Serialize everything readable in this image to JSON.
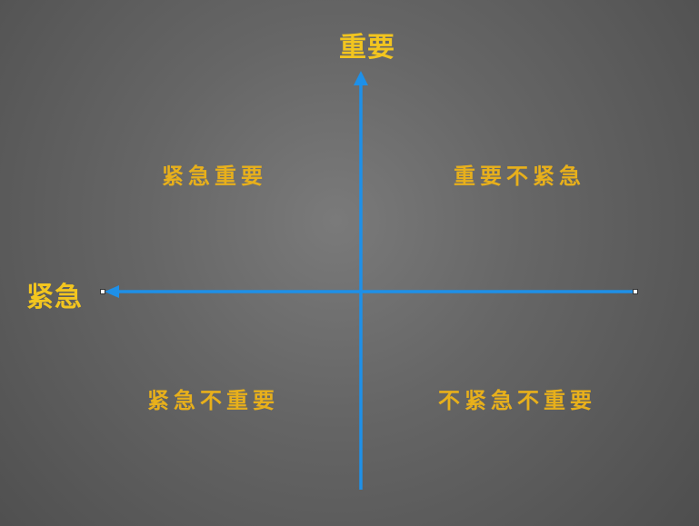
{
  "axes": {
    "vertical_label": "重要",
    "horizontal_label": "紧急"
  },
  "quadrants": {
    "top_left": "紧急重要",
    "top_right": "重要不紧急",
    "bottom_left": "紧急不重要",
    "bottom_right": "不紧急不重要"
  },
  "colors": {
    "axis": "#1e90e8",
    "axis_label": "#f2c51f",
    "quadrant_label": "#e8b01b",
    "endpoint_fill": "#ffffff"
  }
}
